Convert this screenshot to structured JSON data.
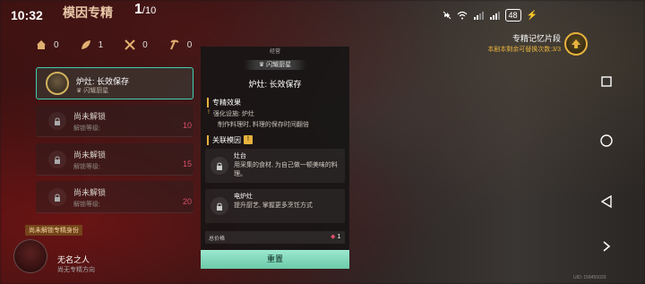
{
  "status_bar": {
    "time": "10:32",
    "battery": "48"
  },
  "header": {
    "title": "模因专精",
    "count_current": "1",
    "count_total": "/10"
  },
  "stats": [
    {
      "icon": "home-icon",
      "value": "0"
    },
    {
      "icon": "leaf-icon",
      "value": "1"
    },
    {
      "icon": "tools-icon",
      "value": "0"
    },
    {
      "icon": "pickaxe-icon",
      "value": "0"
    }
  ],
  "slots": [
    {
      "name": "炉灶: 长效保存",
      "sub": "闪耀厨星",
      "active": true
    },
    {
      "name": "尚未解锁",
      "sub": "解锁等级:",
      "num": "10"
    },
    {
      "name": "尚未解锁",
      "sub": "解锁等级:",
      "num": "15"
    },
    {
      "name": "尚未解锁",
      "sub": "解锁等级:",
      "num": "20"
    }
  ],
  "identity": {
    "tag": "尚未解锁专精身份",
    "name": "无名之人",
    "sub": "尚无专精方向"
  },
  "panel": {
    "category": "经营",
    "badge": "闪耀厨星",
    "title": "炉灶: 长效保存",
    "effect_head": "专精效果",
    "effect_line1": "强化设施: 炉灶",
    "effect_line2": "制作料理时, 料理的保存时间翻倍",
    "related_head": "关联模因",
    "cards": [
      {
        "name": "灶台",
        "desc": "用采集的食材, 为自己做一顿美味的料理。"
      },
      {
        "name": "电炉灶",
        "desc": "提升厨艺, 掌握更多烹饪方式"
      }
    ],
    "price_label": "总价格",
    "price_value": "1",
    "reset_label": "重置"
  },
  "memory": {
    "title": "专精记忆片段",
    "sub": "本剧本剩余可替换次数:3/3"
  },
  "uid": "UID: 158455029",
  "colors": {
    "accent_teal": "#3fd0b0",
    "gold": "#e7b23d",
    "reset_button": "#8ee0c4"
  }
}
